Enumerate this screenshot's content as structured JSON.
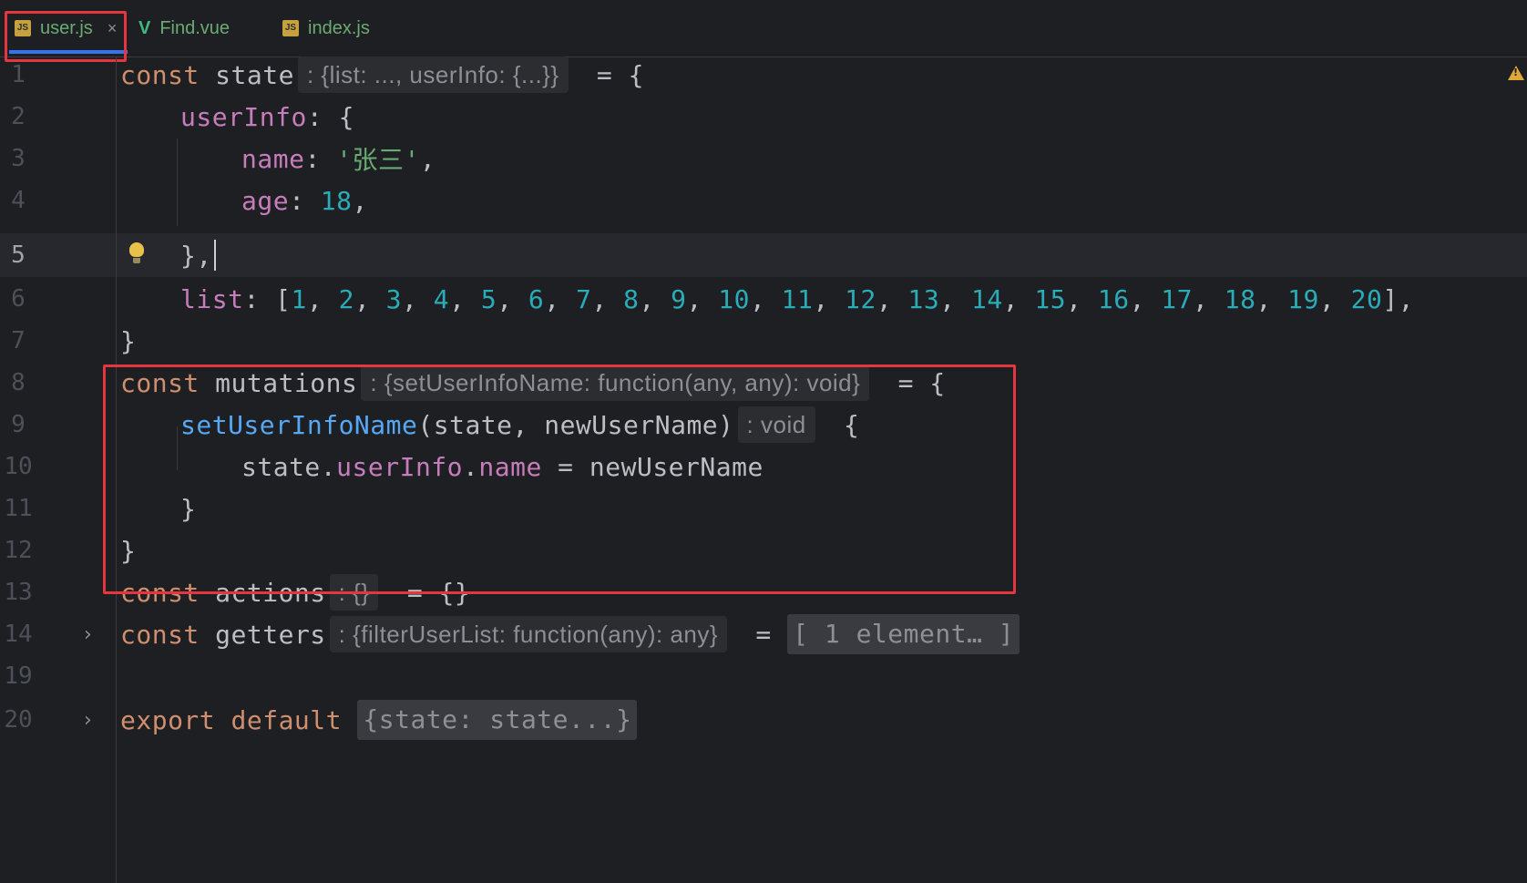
{
  "tabs": [
    {
      "label": "user.js",
      "icon": "js-file-icon",
      "active": true
    },
    {
      "label": "Find.vue",
      "icon": "vue-file-icon",
      "active": false
    },
    {
      "label": "index.js",
      "icon": "js-file-icon",
      "active": false
    }
  ],
  "close_glyph": "×",
  "js_badge": "JS",
  "vue_glyph": "V",
  "lines": [
    {
      "num": "1"
    },
    {
      "num": "2"
    },
    {
      "num": "3"
    },
    {
      "num": "4"
    },
    {
      "num": "5"
    },
    {
      "num": "6"
    },
    {
      "num": "7"
    },
    {
      "num": "8"
    },
    {
      "num": "9"
    },
    {
      "num": "10"
    },
    {
      "num": "11"
    },
    {
      "num": "12"
    },
    {
      "num": "13"
    },
    {
      "num": "14"
    },
    {
      "num": "19"
    },
    {
      "num": "20"
    }
  ],
  "code": {
    "l1": {
      "kw": "const",
      "name": " state",
      "hint": ": {list: ..., userInfo: {...}}",
      "rest": " = {"
    },
    "l2": {
      "prop": "userInfo",
      "rest": ": {"
    },
    "l3": {
      "prop": "name",
      "sep": ": ",
      "str": "'张三'",
      "rest": ","
    },
    "l4": {
      "prop": "age",
      "sep": ": ",
      "num": "18",
      "rest": ","
    },
    "l5": {
      "rest": "},"
    },
    "l6": {
      "prop": "list",
      "open": ": [",
      "nums": [
        "1",
        "2",
        "3",
        "4",
        "5",
        "6",
        "7",
        "8",
        "9",
        "10",
        "11",
        "12",
        "13",
        "14",
        "15",
        "16",
        "17",
        "18",
        "19",
        "20"
      ],
      "close": "],"
    },
    "l7": {
      "rest": "}"
    },
    "l8": {
      "kw": "const",
      "name": " mutations",
      "hint": ": {setUserInfoName: function(any, any): void}",
      "rest": " = {"
    },
    "l9": {
      "fn": "setUserInfoName",
      "args": "(state, newUserName)",
      "hint": ": void",
      "rest": " {"
    },
    "l10": {
      "a": "state.",
      "prop1": "userInfo",
      "dot": ".",
      "prop2": "name",
      "rest": " = newUserName"
    },
    "l11": {
      "rest": "}"
    },
    "l12": {
      "rest": "}"
    },
    "l13": {
      "kw": "const",
      "name": " actions",
      "hint": ": {}",
      "rest": " = {}"
    },
    "l14": {
      "kw": "const",
      "name": " getters",
      "hint": ": {filterUserList: function(any): any}",
      "eq": " = ",
      "fold": "[ 1 element… ]"
    },
    "l20": {
      "kw": "export default",
      "fold": "{state: state...}"
    }
  },
  "colors": {
    "highlight_box": "#e5353f",
    "active_tab_underline": "#3574f0",
    "keyword": "#cf8e6d",
    "property": "#c77dbb",
    "function": "#56a8f5",
    "string": "#6aab73",
    "number": "#2aacb8"
  }
}
